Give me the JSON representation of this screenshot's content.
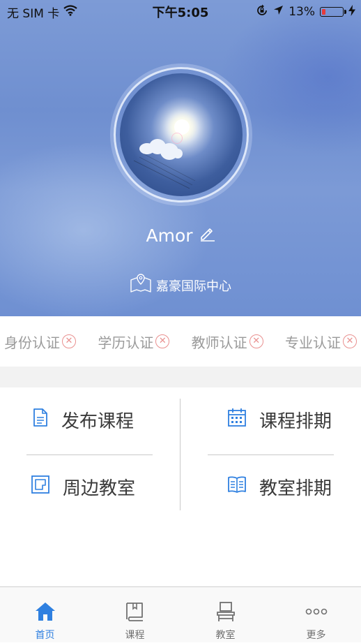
{
  "status_bar": {
    "carrier": "无 SIM 卡",
    "time": "下午5:05",
    "battery_percent": "13%"
  },
  "profile": {
    "username": "Amor",
    "location": "嘉豪国际中心"
  },
  "certifications": [
    {
      "label": "身份认证",
      "verified": false
    },
    {
      "label": "学历认证",
      "verified": false
    },
    {
      "label": "教师认证",
      "verified": false
    },
    {
      "label": "专业认证",
      "verified": false
    }
  ],
  "menu": {
    "publish_course": "发布课程",
    "course_schedule": "课程排期",
    "nearby_classroom": "周边教室",
    "classroom_schedule": "教室排期"
  },
  "tabs": [
    {
      "label": "首页",
      "icon": "home-icon",
      "active": true
    },
    {
      "label": "课程",
      "icon": "book-icon",
      "active": false
    },
    {
      "label": "教室",
      "icon": "chair-icon",
      "active": false
    },
    {
      "label": "更多",
      "icon": "more-icon",
      "active": false
    }
  ],
  "colors": {
    "accent": "#2f80e0",
    "cert_error": "#e9908f",
    "battery_low": "#e63b3b"
  }
}
